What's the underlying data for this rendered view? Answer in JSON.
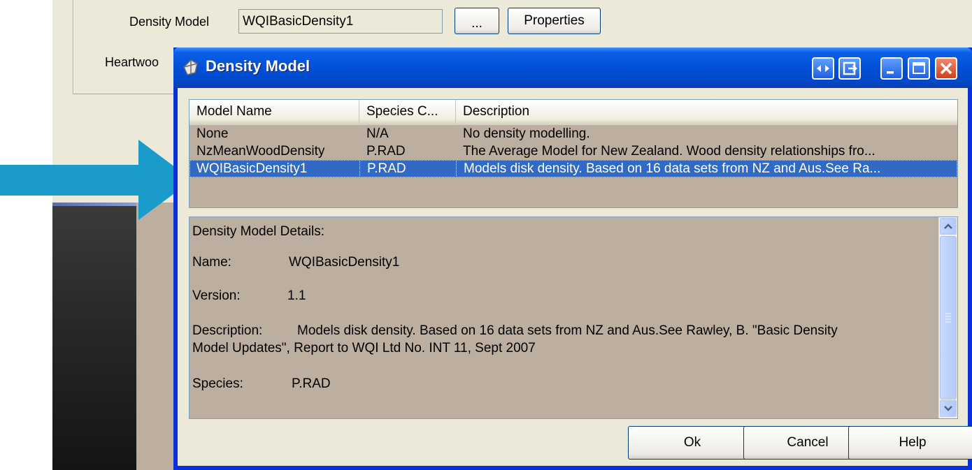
{
  "background_window": {
    "density_model_label": "Density Model",
    "density_model_value": "WQIBasicDensity1",
    "browse_button_label": "...",
    "properties_button_label": "Properties",
    "heartwood_label": "Heartwoo"
  },
  "dialog": {
    "title": "Density Model",
    "list": {
      "columns": [
        "Model Name",
        "Species C...",
        "Description"
      ],
      "rows": [
        {
          "model_name": "None",
          "species": "N/A",
          "description": "No density modelling."
        },
        {
          "model_name": "NzMeanWoodDensity",
          "species": "P.RAD",
          "description": "The Average Model for New Zealand. Wood density relationships fro..."
        },
        {
          "model_name": "WQIBasicDensity1",
          "species": "P.RAD",
          "description": "Models disk density. Based on 16 data sets from NZ and Aus.See Ra..."
        }
      ],
      "selected_row_index": 2
    },
    "details": {
      "heading": "Density Model Details:",
      "name_label": "Name:",
      "name_value": "WQIBasicDensity1",
      "version_label": "Version:",
      "version_value": "1.1",
      "description_label": "Description:",
      "description_line1": "Models disk density. Based on 16 data sets from NZ and Aus.See Rawley, B. \"Basic Density",
      "description_line2": "Model Updates\", Report to WQI Ltd No. INT 11, Sept 2007",
      "species_label": "Species:",
      "species_value": "P.RAD"
    },
    "buttons": {
      "ok": "Ok",
      "cancel": "Cancel",
      "help": "Help"
    }
  },
  "colors": {
    "annotation_arrow": "#1b9bc9",
    "selection": "#316ac5",
    "list_background": "#bcaf9f",
    "titlebar": "#0250d6"
  }
}
